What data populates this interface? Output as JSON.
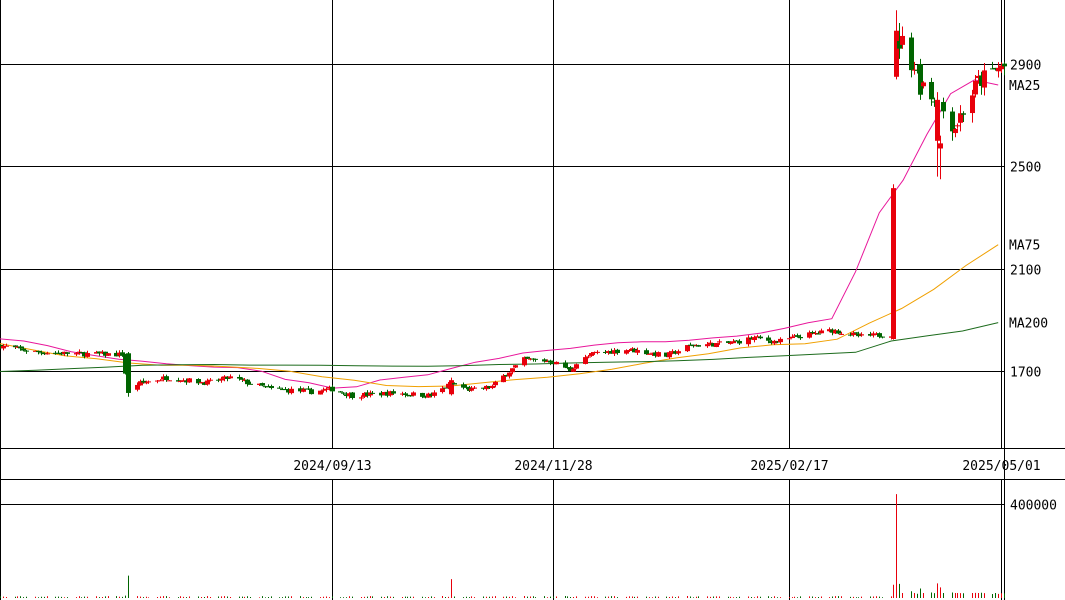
{
  "chart_data": {
    "type": "candlestick",
    "price_axis": {
      "ylim": [
        1400,
        3150
      ],
      "ticks": [
        {
          "value": 1700,
          "label": "1700"
        },
        {
          "value": 2100,
          "label": "2100"
        },
        {
          "value": 2500,
          "label": "2500"
        },
        {
          "value": 2900,
          "label": "2900"
        }
      ]
    },
    "date_axis": {
      "start": "2024-05-22",
      "end": "2025-05-02",
      "ticks": [
        {
          "date": "2024-09-13",
          "label": "2024/09/13"
        },
        {
          "date": "2024-11-28",
          "label": "2024/11/28"
        },
        {
          "date": "2025-02-17",
          "label": "2025/02/17"
        },
        {
          "date": "2025-05-01",
          "label": "2025/05/01"
        }
      ]
    },
    "volume_axis": {
      "ylim": [
        0,
        500000
      ],
      "ticks": [
        {
          "value": 400000,
          "label": "400000"
        }
      ]
    },
    "colors": {
      "up": "#e8000b",
      "down": "#006400",
      "ma25": "#e8179b",
      "ma75": "#f0a000",
      "ma200": "#1c6b1c",
      "grid": "#000000"
    },
    "series": [
      {
        "name": "MA25",
        "labelText": "MA25",
        "values": [
          1826,
          1818,
          1800,
          1776,
          1761,
          1747,
          1739,
          1729,
          1722,
          1716,
          1714,
          1700,
          1668,
          1655,
          1634,
          1639,
          1666,
          1676,
          1686,
          1711,
          1735,
          1750,
          1771,
          1781,
          1789,
          1802,
          1811,
          1815,
          1815,
          1821,
          1830,
          1837,
          1849,
          1867,
          1889,
          1905,
          2089,
          2319,
          2446,
          2625,
          2784,
          2838,
          2818
        ]
      },
      {
        "name": "MA75",
        "labelText": "MA75",
        "values": [
          1808,
          1784,
          1760,
          1749,
          1732,
          1723,
          1723,
          1718,
          1711,
          1700,
          1678,
          1665,
          1644,
          1640,
          1642,
          1655,
          1667,
          1676,
          1690,
          1708,
          1731,
          1752,
          1768,
          1791,
          1803,
          1807,
          1825,
          1888,
          1945,
          2020,
          2113,
          2194
        ]
      },
      {
        "name": "MA200",
        "labelText": "MA200",
        "values": [
          1699,
          1704,
          1710,
          1716,
          1723,
          1725,
          1726,
          1724,
          1724,
          1723,
          1721,
          1720,
          1719,
          1722,
          1726,
          1728,
          1732,
          1735,
          1737,
          1741,
          1746,
          1754,
          1760,
          1767,
          1774,
          1818,
          1838,
          1857,
          1890
        ]
      }
    ]
  }
}
